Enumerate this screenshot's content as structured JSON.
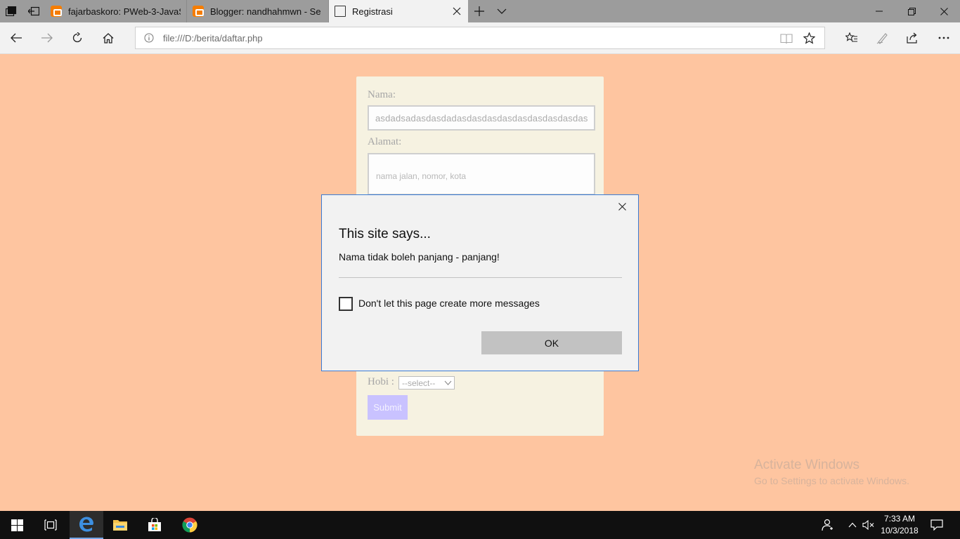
{
  "tabs": [
    {
      "title": "fajarbaskoro: PWeb-3-JavaS",
      "favicon": "blogger-icon",
      "active": false
    },
    {
      "title": "Blogger: nandhahmwn - Se",
      "favicon": "blogger-icon",
      "active": false
    },
    {
      "title": "Registrasi",
      "favicon": "page-icon",
      "active": true
    }
  ],
  "address_bar": {
    "url": "file:///D:/berita/daftar.php"
  },
  "form": {
    "name_label": "Nama:",
    "name_value": "asdadsadasdasdadasdasdasdasdasdasdasdasdas",
    "address_label": "Alamat:",
    "address_placeholder": "nama jalan, nomor, kota",
    "hobi_label": "Hobi :",
    "hobi_selected": "--select--",
    "submit_label": "Submit"
  },
  "dialog": {
    "title": "This site says...",
    "message": "Nama tidak boleh panjang - panjang!",
    "checkbox_label": "Don't let this page create more messages",
    "ok_label": "OK"
  },
  "watermark": {
    "line1": "Activate Windows",
    "line2": "Go to Settings to activate Windows."
  },
  "taskbar": {
    "time": "7:33 AM",
    "date": "10/3/2018"
  },
  "colors": {
    "page_bg": "#fec5a0",
    "form_bg": "#f6f2e1",
    "submit_bg": "#c9c2ff",
    "dialog_border": "#3a7bd5",
    "blogger_orange": "#f57d00"
  }
}
